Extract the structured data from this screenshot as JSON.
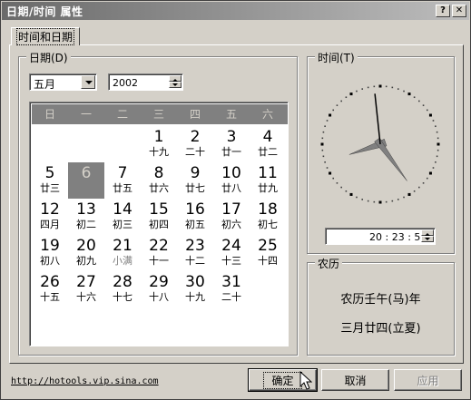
{
  "window": {
    "title": "日期/时间 属性",
    "help_glyph": "?",
    "close_glyph": "✕"
  },
  "tabs": [
    {
      "label": "时间和日期",
      "selected": true
    }
  ],
  "date_group": {
    "legend": "日期(D)",
    "month": "五月",
    "year": "2002"
  },
  "calendar": {
    "weekdays": [
      "日",
      "一",
      "二",
      "三",
      "四",
      "五",
      "六"
    ],
    "first_weekday_index": 3,
    "selected_day": 6,
    "days": [
      {
        "n": "1",
        "l": "十九"
      },
      {
        "n": "2",
        "l": "二十"
      },
      {
        "n": "3",
        "l": "廿一"
      },
      {
        "n": "4",
        "l": "廿二"
      },
      {
        "n": "5",
        "l": "廿三"
      },
      {
        "n": "6",
        "l": ""
      },
      {
        "n": "7",
        "l": "廿五"
      },
      {
        "n": "8",
        "l": "廿六"
      },
      {
        "n": "9",
        "l": "廿七"
      },
      {
        "n": "10",
        "l": "廿八"
      },
      {
        "n": "11",
        "l": "廿九"
      },
      {
        "n": "12",
        "l": "四月"
      },
      {
        "n": "13",
        "l": "初二"
      },
      {
        "n": "14",
        "l": "初三"
      },
      {
        "n": "15",
        "l": "初四"
      },
      {
        "n": "16",
        "l": "初五"
      },
      {
        "n": "17",
        "l": "初六"
      },
      {
        "n": "18",
        "l": "初七"
      },
      {
        "n": "19",
        "l": "初八"
      },
      {
        "n": "20",
        "l": "初九"
      },
      {
        "n": "21",
        "l": "小满",
        "term": true
      },
      {
        "n": "22",
        "l": "十一"
      },
      {
        "n": "23",
        "l": "十二"
      },
      {
        "n": "24",
        "l": "十三"
      },
      {
        "n": "25",
        "l": "十四"
      },
      {
        "n": "26",
        "l": "十五"
      },
      {
        "n": "27",
        "l": "十六"
      },
      {
        "n": "28",
        "l": "十七"
      },
      {
        "n": "29",
        "l": "十八"
      },
      {
        "n": "30",
        "l": "十九"
      },
      {
        "n": "31",
        "l": "二十"
      }
    ]
  },
  "time_group": {
    "legend": "时间(T)",
    "time_value": "20 : 23 : 59",
    "clock": {
      "hour": 20,
      "minute": 23,
      "second": 59
    }
  },
  "lunar_group": {
    "legend": "农历",
    "line1": "农历壬午(马)年",
    "line2": "三月廿四(立夏)"
  },
  "footer": {
    "link": "http://hotools.vip.sina.com",
    "ok_label": "确定",
    "cancel_label": "取消",
    "apply_label": "应用"
  },
  "colors": {
    "face": "#d4d0c8",
    "calendar_header": "#808080",
    "selected_day": "#808080"
  }
}
